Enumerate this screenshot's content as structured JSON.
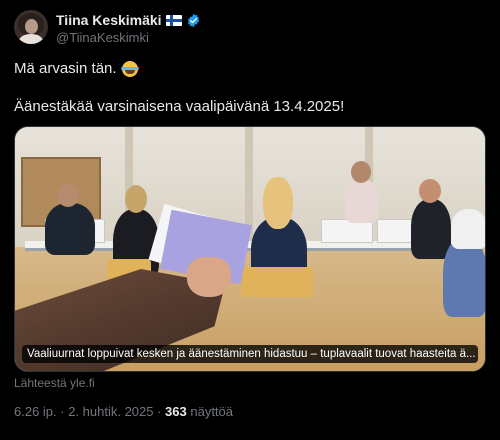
{
  "author": {
    "display_name": "Tiina Keskimäki",
    "handle": "@TiinaKeskimki",
    "flag_icon": "finland-flag-icon",
    "verified_icon": "verified-badge-icon",
    "verified_color": "#1d9bf0"
  },
  "tweet": {
    "line1": "Mä arvasin tän.",
    "emoji_icon": "face-with-tears-of-joy-icon",
    "line2": "Äänestäkää varsinaisena vaalipäivänä 13.4.2025!"
  },
  "media": {
    "caption": "Vaaliuurnat loppuivat kesken ja äänestäminen hidastuu – tuplavaalit tuovat haasteita ä..."
  },
  "link_source": "Lähteestä yle.fi",
  "meta": {
    "time_date": "6.26 ip. · 2. huhtik. 2025 · ",
    "views_count": "363",
    "views_label": " näyttöä"
  },
  "colors": {
    "background": "#000000",
    "text_primary": "#e7e9ea",
    "text_secondary": "#71767b"
  }
}
